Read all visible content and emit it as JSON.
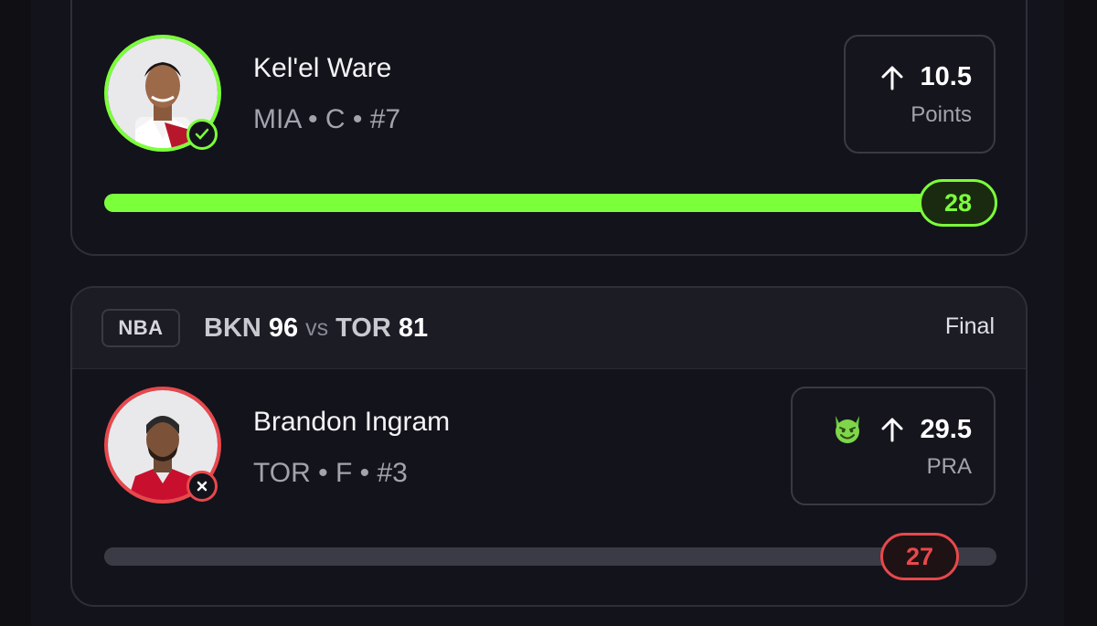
{
  "picks": [
    {
      "player_name": "Kel'el Ware",
      "meta": "MIA • C • #7",
      "direction_icon": "arrow-up-icon",
      "line": "10.5",
      "stat": "Points",
      "result": "28",
      "status": "hit",
      "progress": 1.0,
      "accent": "#7cff3b"
    },
    {
      "league": "NBA",
      "game": {
        "home": "BKN",
        "home_score": "96",
        "vs": "vs",
        "away": "TOR",
        "away_score": "81",
        "status": "Final"
      },
      "player_name": "Brandon Ingram",
      "meta": "TOR • F • #3",
      "modifier_icon": "devil-emoji-icon",
      "direction_icon": "arrow-up-icon",
      "line": "29.5",
      "stat": "PRA",
      "result": "27",
      "status": "miss",
      "progress": 0.915,
      "accent": "#e8484c"
    }
  ]
}
